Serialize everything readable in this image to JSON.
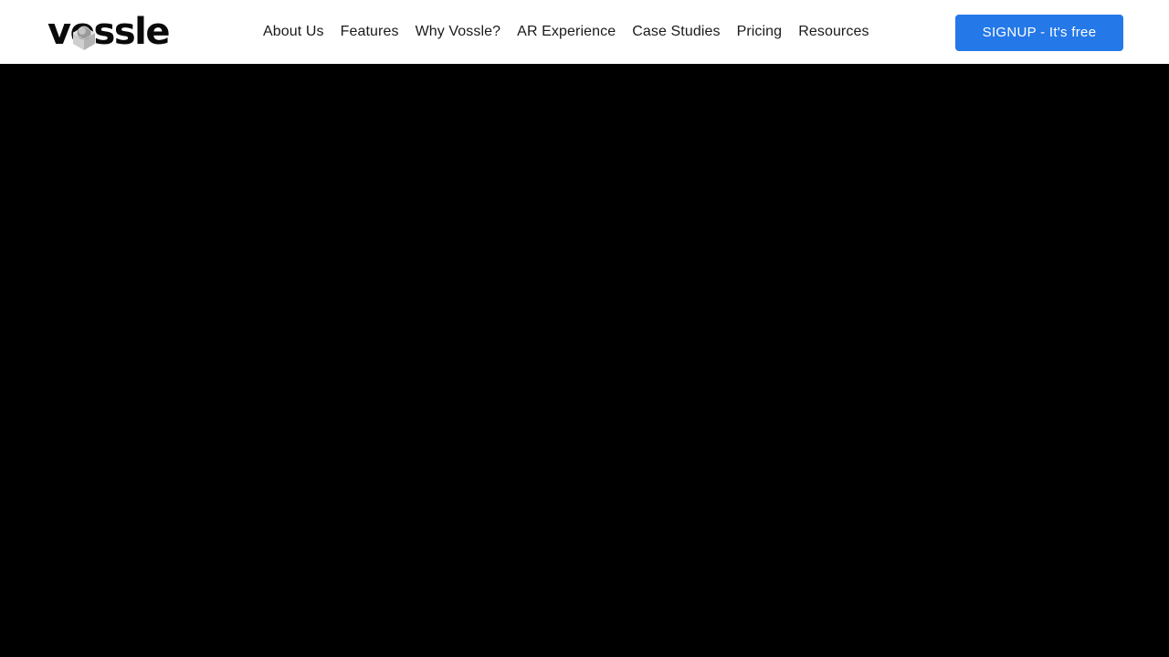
{
  "header": {
    "logo": {
      "text": "vossle",
      "icon": "cube-sphere-logo-icon",
      "cube_color": "#d9d9d9",
      "cube_shade_color": "#b0b0b0",
      "sphere_color": "#8f8f8f",
      "wordmark_color": "#0a0a0a"
    },
    "nav": {
      "items": [
        {
          "label": "About Us"
        },
        {
          "label": "Features"
        },
        {
          "label": "Why Vossle?"
        },
        {
          "label": "AR Experience"
        },
        {
          "label": "Case Studies"
        },
        {
          "label": "Pricing"
        },
        {
          "label": "Resources"
        }
      ],
      "link_color": "#1a1a1a"
    },
    "cta": {
      "label": "SIGNUP - It's free",
      "background_color": "#2478e8",
      "text_color": "#ffffff"
    },
    "background_color": "#ffffff"
  },
  "hero": {
    "background_color": "#000000",
    "media": "hero-video-placeholder",
    "content": ""
  }
}
